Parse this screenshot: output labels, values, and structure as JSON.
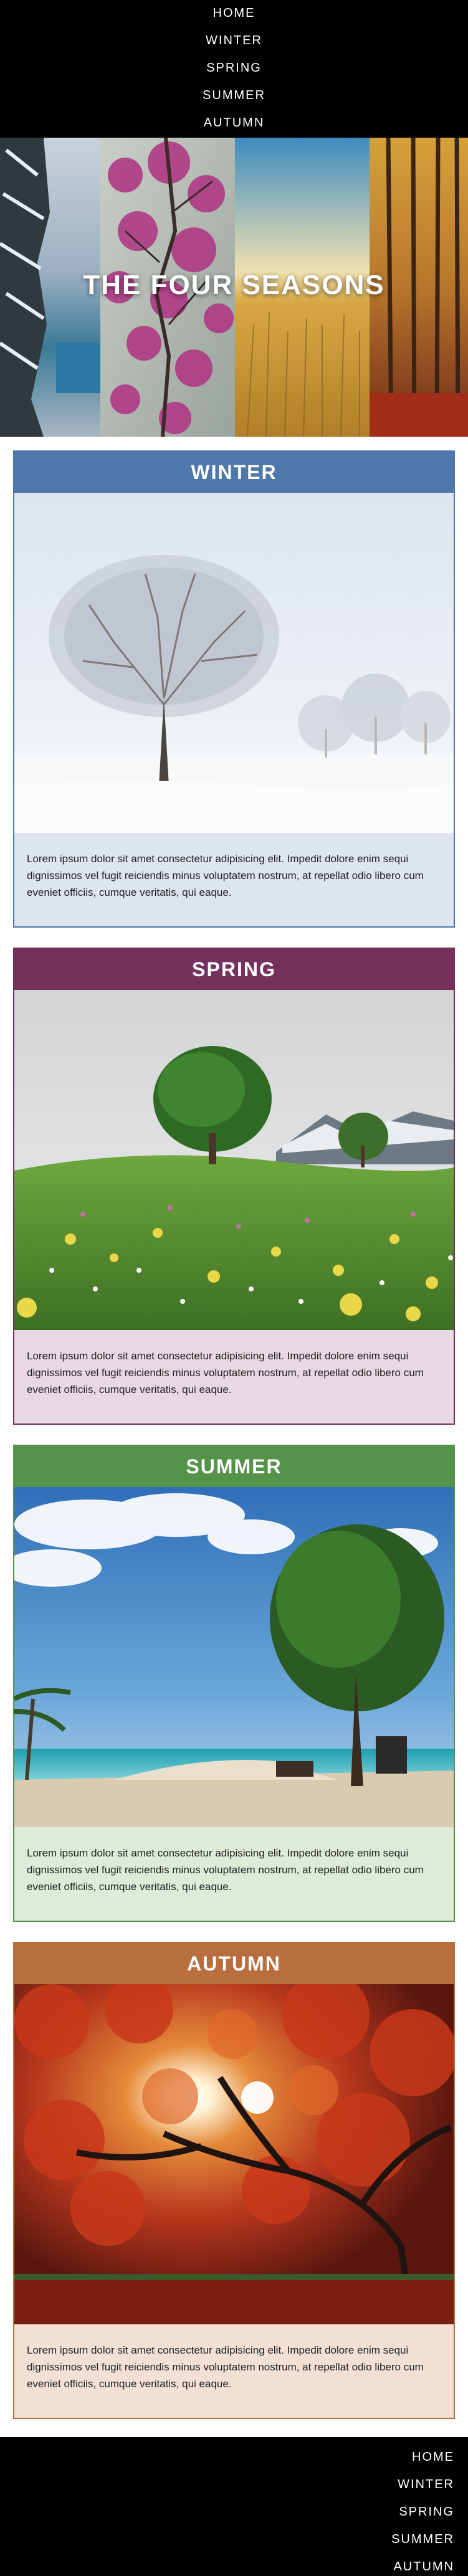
{
  "nav": {
    "items": [
      "HOME",
      "WINTER",
      "SPRING",
      "SUMMER",
      "AUTUMN"
    ]
  },
  "hero": {
    "title": "THE FOUR SEASONS"
  },
  "seasons": [
    {
      "title": "WINTER",
      "text": "Lorem ipsum dolor sit amet consectetur adipisicing elit. Impedit dolore enim sequi dignissimos vel fugit reiciendis minus voluptatem nostrum, at repellat odio libero cum eveniet officiis, cumque veritatis, qui eaque.",
      "colors": {
        "header": "#4f77a9",
        "border": "#4f77a9",
        "body": "#dfe5ef"
      }
    },
    {
      "title": "SPRING",
      "text": "Lorem ipsum dolor sit amet consectetur adipisicing elit. Impedit dolore enim sequi dignissimos vel fugit reiciendis minus voluptatem nostrum, at repellat odio libero cum eveniet officiis, cumque veritatis, qui eaque.",
      "colors": {
        "header": "#75305e",
        "border": "#75305e",
        "body": "#e8d8e1"
      }
    },
    {
      "title": "SUMMER",
      "text": "Lorem ipsum dolor sit amet consectetur adipisicing elit. Impedit dolore enim sequi dignissimos vel fugit reiciendis minus voluptatem nostrum, at repellat odio libero cum eveniet officiis, cumque veritatis, qui eaque.",
      "colors": {
        "header": "#55924a",
        "border": "#55924a",
        "body": "#deebd9"
      }
    },
    {
      "title": "AUTUMN",
      "text": "Lorem ipsum dolor sit amet consectetur adipisicing elit. Impedit dolore enim sequi dignissimos vel fugit reiciendis minus voluptatem nostrum, at repellat odio libero cum eveniet officiis, cumque veritatis, qui eaque.",
      "colors": {
        "header": "#b96e3e",
        "border": "#b96e3e",
        "body": "#f2e0d5"
      }
    }
  ],
  "colors": {
    "nav_bg": "#000000",
    "nav_text": "#ffffff"
  }
}
